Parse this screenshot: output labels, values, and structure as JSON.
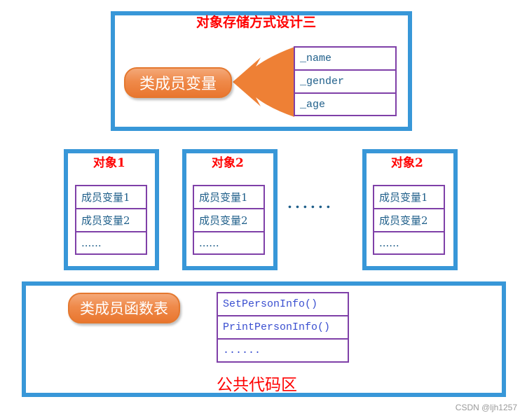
{
  "top_section": {
    "title": "对象存储方式设计三",
    "label": "类成员变量",
    "members": [
      "_name",
      "_gender",
      "_age"
    ]
  },
  "objects": [
    {
      "title": "对象1",
      "rows": [
        "成员变量1",
        "成员变量2",
        "......"
      ]
    },
    {
      "title": "对象2",
      "rows": [
        "成员变量1",
        "成员变量2",
        "......"
      ]
    },
    {
      "title": "对象2",
      "rows": [
        "成员变量1",
        "成员变量2",
        "......"
      ]
    }
  ],
  "ellipsis": "......",
  "bottom_section": {
    "label": "类成员函数表",
    "functions": [
      "SetPersonInfo()",
      "PrintPersonInfo()",
      "......"
    ],
    "caption": "公共代码区"
  },
  "watermark": "CSDN @ljh1257",
  "colors": {
    "frame": "#3897d8",
    "table_border": "#7f40a8",
    "title_red": "#ff0000",
    "accent_orange": "#ee8035",
    "text_blue": "#1f5f8a",
    "function_blue": "#3a4fd0"
  }
}
